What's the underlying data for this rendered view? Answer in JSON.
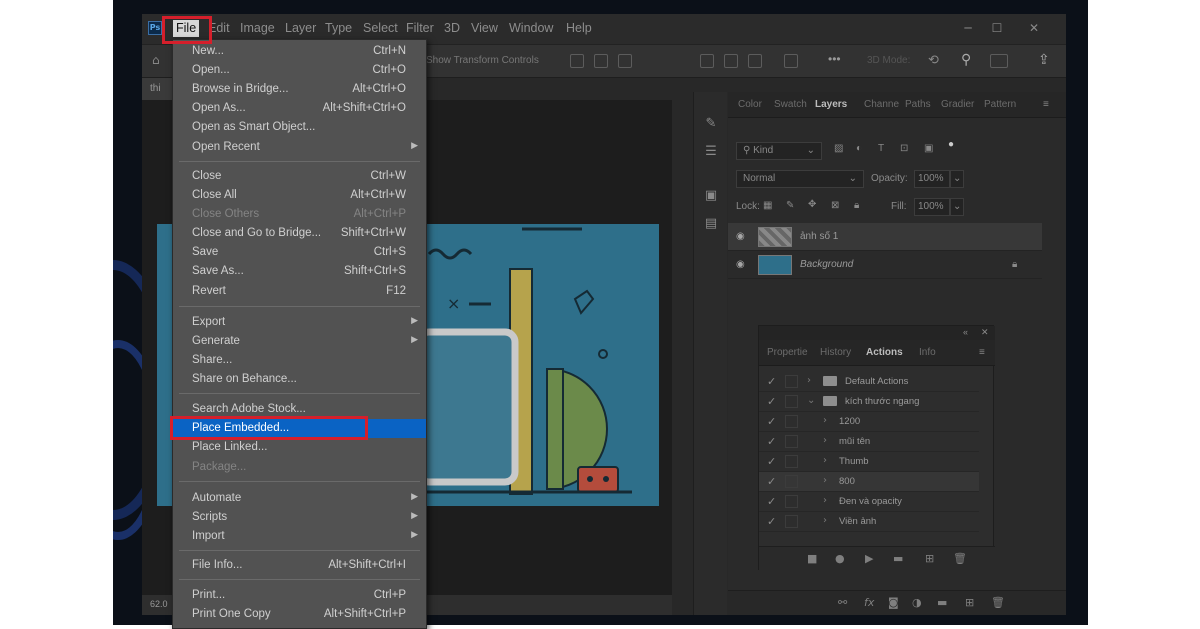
{
  "menubar": {
    "app_logo": "Ps",
    "items": [
      {
        "label": "File"
      },
      {
        "label": "Edit"
      },
      {
        "label": "Image"
      },
      {
        "label": "Layer"
      },
      {
        "label": "Type"
      },
      {
        "label": "Select"
      },
      {
        "label": "Filter"
      },
      {
        "label": "3D"
      },
      {
        "label": "View"
      },
      {
        "label": "Window"
      },
      {
        "label": "Help"
      }
    ],
    "window_controls": {
      "minimize": "─",
      "maximize": "☐",
      "close": "✕"
    }
  },
  "options_bar": {
    "show_transform_label": "Show Transform Controls",
    "mode_3d_label": "3D Mode:",
    "more_label": "•••"
  },
  "document": {
    "tab_label": "thi",
    "zoom_status": "62.0"
  },
  "file_menu": {
    "groups": [
      [
        {
          "label": "New...",
          "shortcut": "Ctrl+N"
        },
        {
          "label": "Open...",
          "shortcut": "Ctrl+O"
        },
        {
          "label": "Browse in Bridge...",
          "shortcut": "Alt+Ctrl+O"
        },
        {
          "label": "Open As...",
          "shortcut": "Alt+Shift+Ctrl+O"
        },
        {
          "label": "Open as Smart Object...",
          "shortcut": ""
        },
        {
          "label": "Open Recent",
          "shortcut": "",
          "submenu": true
        }
      ],
      [
        {
          "label": "Close",
          "shortcut": "Ctrl+W"
        },
        {
          "label": "Close All",
          "shortcut": "Alt+Ctrl+W"
        },
        {
          "label": "Close Others",
          "shortcut": "Alt+Ctrl+P",
          "disabled": true
        },
        {
          "label": "Close and Go to Bridge...",
          "shortcut": "Shift+Ctrl+W"
        },
        {
          "label": "Save",
          "shortcut": "Ctrl+S"
        },
        {
          "label": "Save As...",
          "shortcut": "Shift+Ctrl+S"
        },
        {
          "label": "Revert",
          "shortcut": "F12"
        }
      ],
      [
        {
          "label": "Export",
          "shortcut": "",
          "submenu": true
        },
        {
          "label": "Generate",
          "shortcut": "",
          "submenu": true
        },
        {
          "label": "Share...",
          "shortcut": ""
        },
        {
          "label": "Share on Behance...",
          "shortcut": ""
        }
      ],
      [
        {
          "label": "Search Adobe Stock...",
          "shortcut": ""
        },
        {
          "label": "Place Embedded...",
          "shortcut": "",
          "highlighted": true
        },
        {
          "label": "Place Linked...",
          "shortcut": ""
        },
        {
          "label": "Package...",
          "shortcut": "",
          "disabled": true
        }
      ],
      [
        {
          "label": "Automate",
          "shortcut": "",
          "submenu": true
        },
        {
          "label": "Scripts",
          "shortcut": "",
          "submenu": true
        },
        {
          "label": "Import",
          "shortcut": "",
          "submenu": true
        }
      ],
      [
        {
          "label": "File Info...",
          "shortcut": "Alt+Shift+Ctrl+I"
        }
      ],
      [
        {
          "label": "Print...",
          "shortcut": "Ctrl+P"
        },
        {
          "label": "Print One Copy",
          "shortcut": "Alt+Shift+Ctrl+P"
        }
      ]
    ]
  },
  "layers_panel": {
    "tabs": [
      "Color",
      "Swatch",
      "Layers",
      "Channe",
      "Paths",
      "Gradier",
      "Pattern"
    ],
    "active_tab": "Layers",
    "filter_label": "Kind",
    "blend_mode": "Normal",
    "opacity_label": "Opacity:",
    "opacity_value": "100%",
    "lock_label": "Lock:",
    "fill_label": "Fill:",
    "fill_value": "100%",
    "layers": [
      {
        "name": "ảnh số 1",
        "selected": true
      },
      {
        "name": "Background",
        "locked": true
      }
    ]
  },
  "actions_panel": {
    "tabs": [
      "Propertie",
      "History",
      "Actions",
      "Info"
    ],
    "active_tab": "Actions",
    "rows": [
      {
        "label": "Default Actions",
        "level": 0,
        "folder": true
      },
      {
        "label": "kích thước ngang",
        "level": 0,
        "folder": true,
        "expanded": true
      },
      {
        "label": "1200",
        "level": 1
      },
      {
        "label": "mũi tên",
        "level": 1
      },
      {
        "label": "Thumb",
        "level": 1
      },
      {
        "label": "800",
        "level": 1,
        "selected": true
      },
      {
        "label": "Đen và opacity",
        "level": 1
      },
      {
        "label": "Viền ảnh",
        "level": 1
      }
    ]
  },
  "colors": {
    "highlight": "#0a63c4",
    "annotation_red": "#d51f2b",
    "canvas_bg": "#2e6f8a"
  }
}
